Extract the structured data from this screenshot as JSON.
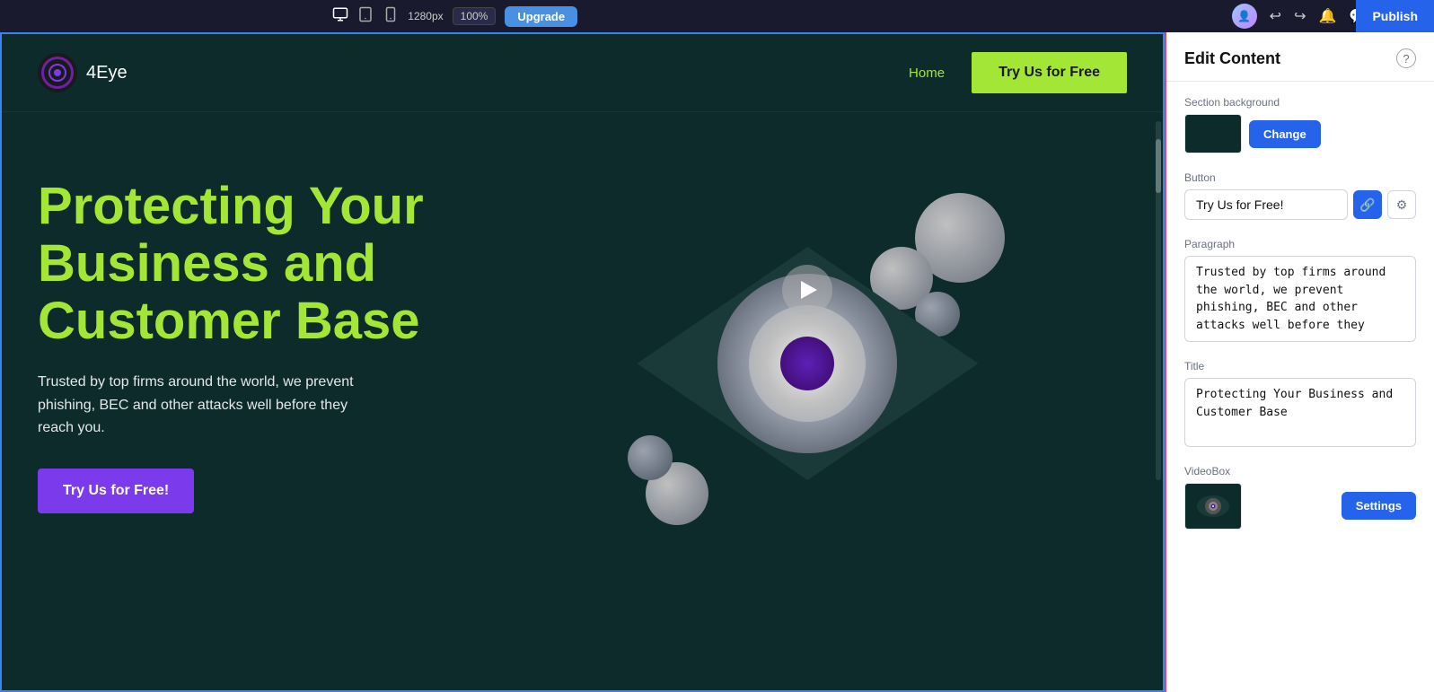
{
  "toolbar": {
    "resolution": "1280px",
    "zoom": "100%",
    "upgrade_label": "Upgrade",
    "publish_label": "Publish"
  },
  "site": {
    "logo_text": "4Eye",
    "nav": {
      "home_label": "Home"
    },
    "cta_button": "Try Us for Free",
    "hero": {
      "title": "Protecting Your Business and Customer Base",
      "subtitle": "Trusted by top firms around the world, we prevent phishing, BEC and other attacks well before they reach you.",
      "cta_label": "Try Us for Free!"
    }
  },
  "edit_panel": {
    "title": "Edit Content",
    "help_label": "?",
    "section_background_label": "Section background",
    "change_label": "Change",
    "button_label": "Button",
    "button_value": "Try Us for Free!",
    "link_icon": "🔗",
    "gear_icon": "⚙",
    "paragraph_label": "Paragraph",
    "paragraph_value": "Trusted by top firms around the world, we prevent phishing, BEC and other attacks well before they",
    "title_label": "Title",
    "title_value": "Protecting Your Business and Customer Base",
    "videobox_label": "VideoBox",
    "settings_label": "Settings"
  }
}
